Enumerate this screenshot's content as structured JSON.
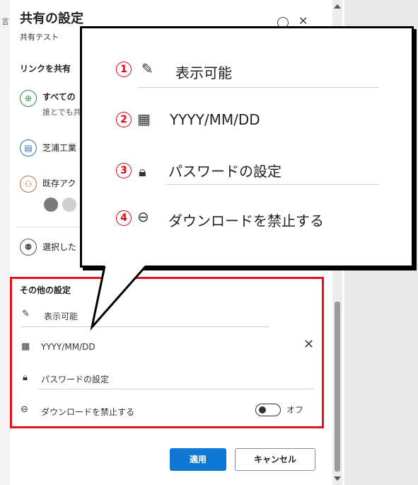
{
  "panel": {
    "title": "共有の設定",
    "subtitle": "共有テスト",
    "link_section_label": "リンクを共有"
  },
  "link_options": [
    {
      "label": "すべての",
      "sub": "誰とでも共",
      "icon": "globe-icon"
    },
    {
      "label": "芝浦工業",
      "icon": "org-icon"
    },
    {
      "label": "既存アク",
      "icon": "people-icon"
    },
    {
      "label": "選択した",
      "icon": "person-add-icon"
    }
  ],
  "other_settings": {
    "title": "その他の設定",
    "view_label": "表示可能",
    "date_placeholder": "YYYY/MM/DD",
    "password_label": "パスワードの設定",
    "download_label": "ダウンロードを禁止する",
    "toggle_label": "オフ",
    "toggle_state": "off"
  },
  "footer": {
    "apply_label": "適用",
    "cancel_label": "キャンセル"
  },
  "callout": {
    "items": [
      {
        "number": "1",
        "icon": "pencil-off-icon",
        "label": "表示可能"
      },
      {
        "number": "2",
        "icon": "calendar-icon",
        "label": "YYYY/MM/DD"
      },
      {
        "number": "3",
        "icon": "lock-icon",
        "label": "パスワードの設定"
      },
      {
        "number": "4",
        "icon": "minus-circle-icon",
        "label": "ダウンロードを禁止する"
      }
    ]
  },
  "colors": {
    "accent": "#0f78d4",
    "highlight": "#e1141e",
    "number": "#e60012"
  }
}
